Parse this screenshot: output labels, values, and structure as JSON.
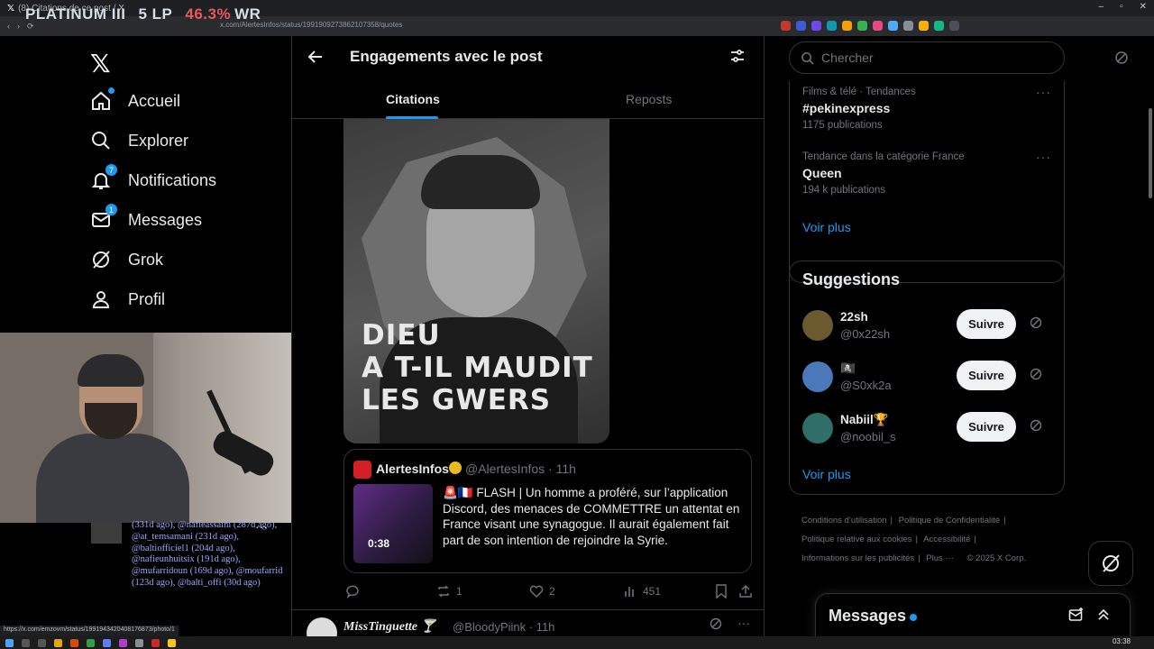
{
  "browser": {
    "tab_title": "(8) Citations de ce post / X",
    "url": "x.com/AlertesInfos/status/1991909273862107358/quotes",
    "status_url": "https://x.com/emzovm/status/1991943420408176873/photo/1"
  },
  "rank_overlay": {
    "tier": "PLATINUM III",
    "lp": "5 LP",
    "wr": "46.3%",
    "wr_suffix": "WR"
  },
  "nav": {
    "items": [
      {
        "label": "Accueil",
        "icon": "home-icon",
        "dot": true
      },
      {
        "label": "Explorer",
        "icon": "search-icon"
      },
      {
        "label": "Notifications",
        "icon": "bell-icon",
        "badge": "7"
      },
      {
        "label": "Messages",
        "icon": "mail-icon",
        "badge": "1"
      },
      {
        "label": "Grok",
        "icon": "grok-icon"
      },
      {
        "label": "Profil",
        "icon": "person-icon"
      }
    ]
  },
  "chatlog": {
    "text": "(331d ago), @nafieassalhi (287d ago), @at_temsamani (231d ago), @baltiofficiel1 (204d ago), @nafieunhuitsix (191d ago), @mufarridoun (169d ago), @moufarrid (123d ago), @balti_offi (30d ago)"
  },
  "main": {
    "title": "Engagements avec le post",
    "tabs": [
      {
        "label": "Citations",
        "active": true
      },
      {
        "label": "Reposts",
        "active": false
      }
    ],
    "image_caption": "DIEU\nA T-IL MAUDIT\nLES GWERS",
    "embedded": {
      "name": "AlertesInfos",
      "handle": "@AlertesInfos · 11h",
      "duration": "0:38",
      "text": "🚨🇫🇷 FLASH | Un homme a proféré, sur l’application Discord, des menaces de COMMETTRE un attentat en France visant une synagogue. Il aurait également fait part de son intention de rejoindre la Syrie."
    },
    "actions": {
      "reposts": "1",
      "likes": "2",
      "views": "451"
    },
    "next_post": {
      "name": "MissTinguette 🍸",
      "handle": "@BloodyPiink · 11h"
    }
  },
  "right": {
    "search_placeholder": "Chercher",
    "trends": [
      {
        "category": "Films & télé · Tendances",
        "title": "#pekinexpress",
        "count": "1175 publications"
      },
      {
        "category": "Tendance dans la catégorie France",
        "title": "Queen",
        "count": "194 k publications"
      }
    ],
    "see_more": "Voir plus",
    "suggestions_title": "Suggestions",
    "suggestions": [
      {
        "name": "22sh",
        "handle": "@0x22sh",
        "color": "#6b5a2e"
      },
      {
        "name": "🏴‍☠️",
        "handle": "@S0xk2a",
        "color": "#4a78b8"
      },
      {
        "name": "Nabiil🏆",
        "handle": "@noobil_s",
        "color": "#2f6f6a"
      }
    ],
    "follow_label": "Suivre",
    "suggestions_more": "Voir plus",
    "footer": [
      "Conditions d’utilisation",
      "Politique de Confidentialité",
      "Politique relative aux cookies",
      "Accessibilité",
      "Informations sur les publicités",
      "Plus ···",
      "© 2025 X Corp."
    ],
    "messages_title": "Messages"
  },
  "taskbar": {
    "clock": "03:38"
  },
  "colors": {
    "accent": "#1d9bf0",
    "background": "#000000",
    "border": "#2f3336",
    "muted": "#71767b",
    "rank_wr": "#e8595f"
  }
}
